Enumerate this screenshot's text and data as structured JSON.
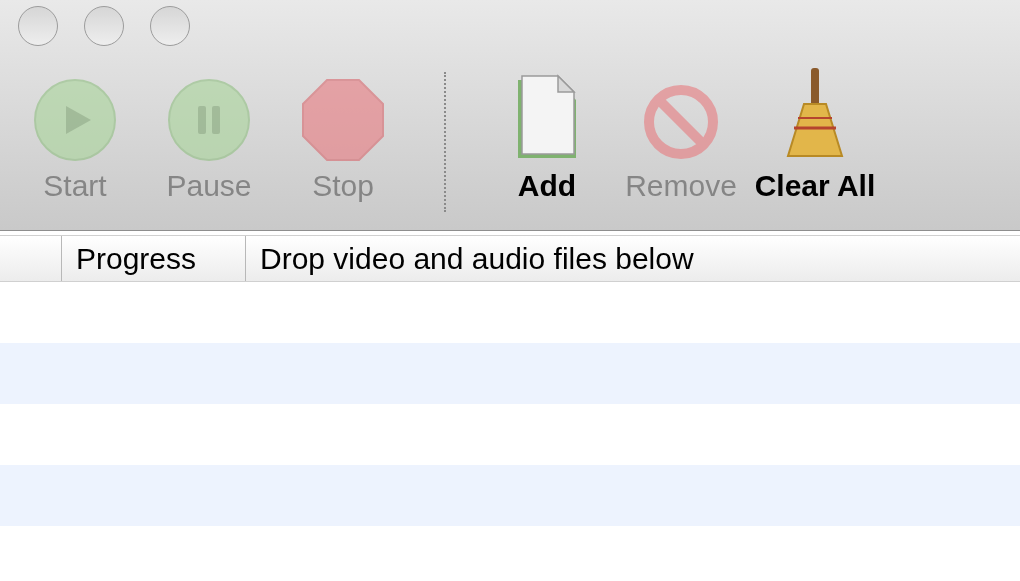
{
  "toolbar": {
    "buttons": [
      {
        "kind": "start",
        "label": "Start",
        "disabled": true
      },
      {
        "kind": "pause",
        "label": "Pause",
        "disabled": true
      },
      {
        "kind": "stop",
        "label": "Stop",
        "disabled": true
      },
      {
        "kind": "separator"
      },
      {
        "kind": "add",
        "label": "Add",
        "disabled": false
      },
      {
        "kind": "remove",
        "label": "Remove",
        "disabled": true
      },
      {
        "kind": "clear",
        "label": "Clear All",
        "disabled": false
      }
    ]
  },
  "table": {
    "columns": [
      "Progress",
      "Drop video and audio files below"
    ]
  }
}
